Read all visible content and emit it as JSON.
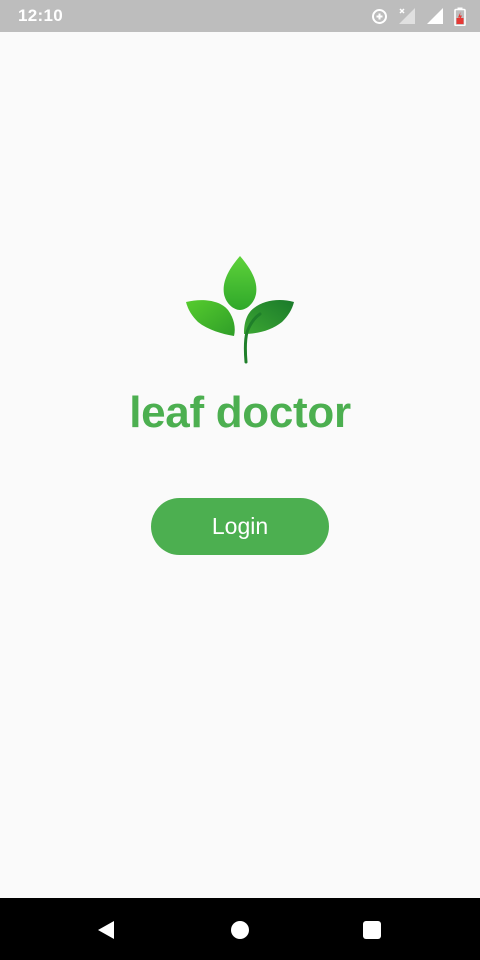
{
  "status_bar": {
    "time": "12:10",
    "icons": [
      "data-saver-icon",
      "signal-no-data-icon",
      "signal-icon",
      "battery-charging-icon"
    ],
    "battery_color": "#e53935"
  },
  "main": {
    "logo_icon": "leaf-sprout-icon",
    "app_title": "leaf doctor",
    "login_label": "Login"
  },
  "nav_bar": {
    "icons": [
      "back-icon",
      "home-icon",
      "recents-icon"
    ]
  },
  "colors": {
    "brand_green": "#4caf50",
    "background": "#fafafa",
    "status_bar": "#bdbdbd",
    "nav_bar": "#000000"
  }
}
